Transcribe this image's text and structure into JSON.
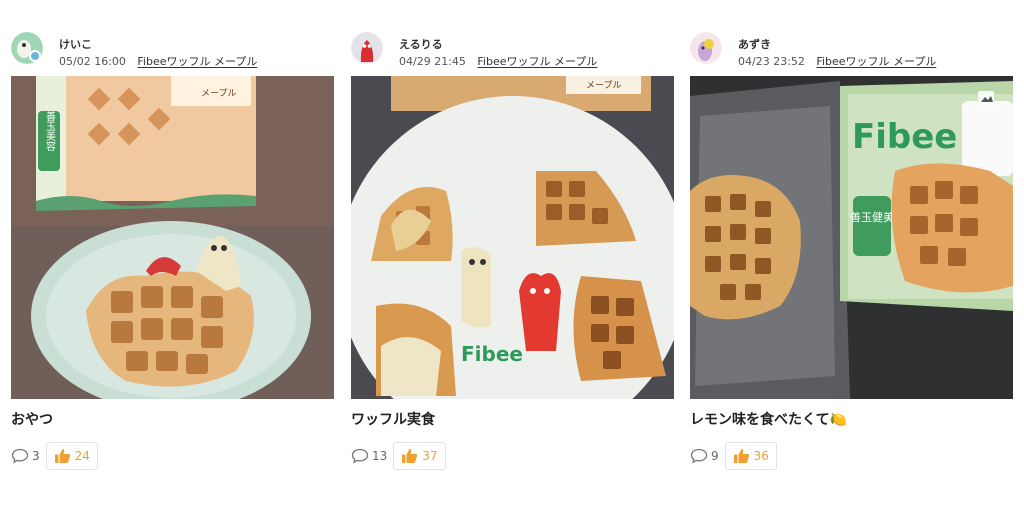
{
  "posts": [
    {
      "username": "けいこ",
      "date": "05/02 16:00",
      "product": "Fibeeワッフル メープル",
      "title": "おやつ",
      "comments": "3",
      "likes": "24",
      "package_label": "メープル",
      "package_badge": "善玉美容"
    },
    {
      "username": "えるりる",
      "date": "04/29 21:45",
      "product": "Fibeeワッフル メープル",
      "title": "ワッフル実食",
      "comments": "13",
      "likes": "37",
      "package_label": "メープル",
      "plate_brand": "Fibee"
    },
    {
      "username": "あずき",
      "date": "04/23 23:52",
      "product": "Fibeeワッフル メープル",
      "title": "レモン味を食べたくて🍋",
      "comments": "9",
      "likes": "36",
      "package_brand": "Fibee",
      "package_badge": "善玉健美"
    }
  ],
  "colors": {
    "like": "#f0a030",
    "package_green": "#2e9a5a"
  }
}
